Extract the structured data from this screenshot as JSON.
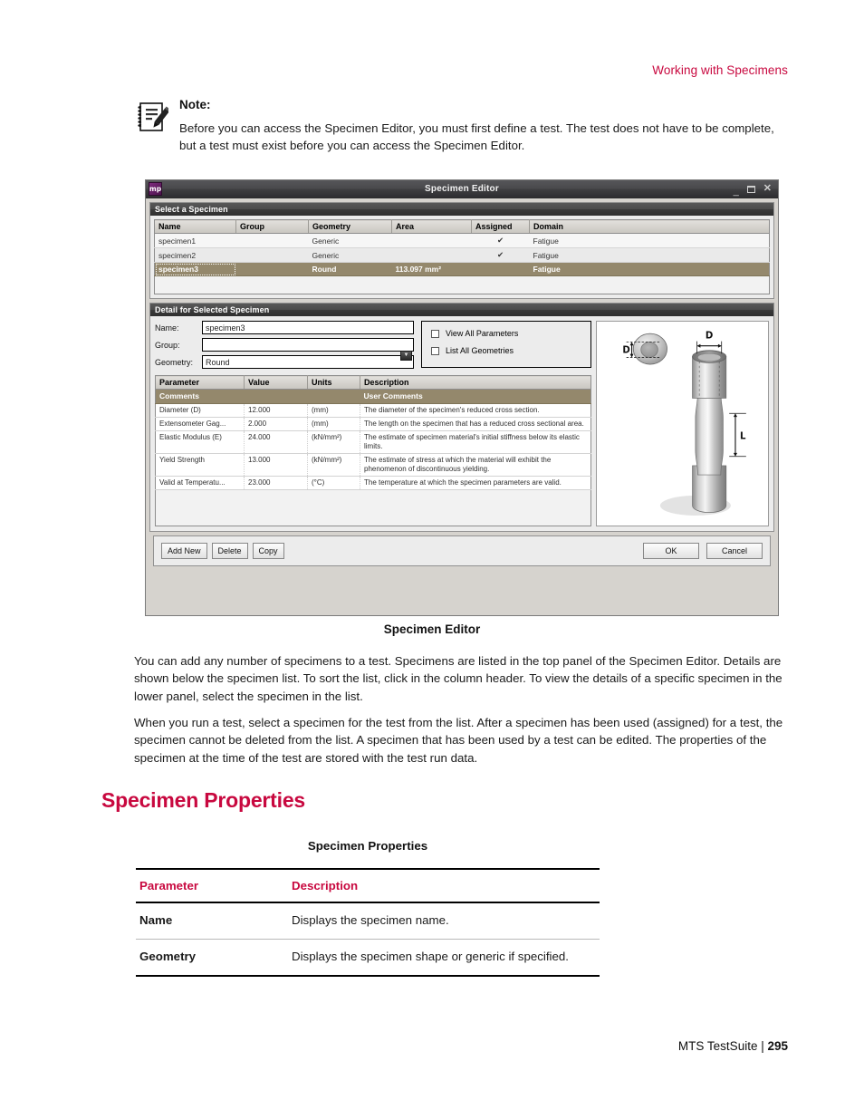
{
  "page": {
    "running_head": "Working with Specimens",
    "footer_label": "MTS TestSuite | ",
    "footer_page": "295"
  },
  "note": {
    "icon": "notepad-pencil-icon",
    "title": "Note:",
    "text": "Before you can access the Specimen Editor, you must first define a test. The test does not have to be complete, but a test must exist before you can access the Specimen Editor."
  },
  "app_window": {
    "app_icon_text": "mp",
    "title": "Specimen Editor",
    "controls": {
      "minimize": "_",
      "maximize": "maximize-icon",
      "close": "×"
    },
    "select_panel": {
      "header": "Select a Specimen",
      "columns": [
        "Name",
        "Group",
        "Geometry",
        "Area",
        "Assigned",
        "Domain"
      ],
      "rows": [
        {
          "name": "specimen1",
          "group": "",
          "geometry": "Generic",
          "area": "",
          "assigned": "✔",
          "domain": "Fatigue",
          "selected": false
        },
        {
          "name": "specimen2",
          "group": "",
          "geometry": "Generic",
          "area": "",
          "assigned": "✔",
          "domain": "Fatigue",
          "selected": false
        },
        {
          "name": "specimen3",
          "group": "",
          "geometry": "Round",
          "area": "113.097 mm²",
          "assigned": "",
          "domain": "Fatigue",
          "selected": true
        }
      ]
    },
    "detail_panel": {
      "header": "Detail for Selected Specimen",
      "fields": {
        "name_label": "Name:",
        "name_value": "specimen3",
        "group_label": "Group:",
        "group_value": "",
        "geometry_label": "Geometry:",
        "geometry_value": "Round"
      },
      "checkboxes": [
        {
          "label": "View All Parameters",
          "checked": false
        },
        {
          "label": "List All Geometries",
          "checked": false
        }
      ],
      "param_columns": [
        "Parameter",
        "Value",
        "Units",
        "Description"
      ],
      "comments_row": {
        "parameter": "Comments",
        "description": "User Comments"
      },
      "param_rows": [
        {
          "parameter": "Diameter (D)",
          "value": "12.000",
          "units": "(mm)",
          "description": "The diameter of the specimen's reduced cross section."
        },
        {
          "parameter": "Extensometer Gag...",
          "value": "2.000",
          "units": "(mm)",
          "description": "The length on the specimen that has a reduced cross sectional area."
        },
        {
          "parameter": "Elastic Modulus (E)",
          "value": "24.000",
          "units": "(kN/mm²)",
          "description": "The estimate of specimen material's initial stiffness below its elastic limits."
        },
        {
          "parameter": "Yield Strength",
          "value": "13.000",
          "units": "(kN/mm²)",
          "description": "The estimate of stress at which the material will exhibit the phenomenon of discontinuous yielding."
        },
        {
          "parameter": "Valid at Temperatu...",
          "value": "23.000",
          "units": "(°C)",
          "description": "The temperature at which the specimen parameters are valid."
        }
      ],
      "illustration": {
        "name": "round-specimen-diagram",
        "diameter_label": "D",
        "diameter_label_top": "D",
        "length_label": "L"
      }
    },
    "buttons": {
      "add_new": "Add New",
      "delete": "Delete",
      "copy": "Copy",
      "ok": "OK",
      "cancel": "Cancel"
    }
  },
  "figure_caption": "Specimen Editor",
  "paragraphs": {
    "p1": "You can add any number of specimens to a test. Specimens are listed in the top panel of the Specimen Editor. Details are shown below the specimen list. To sort the list, click in the column header. To view the details of a specific specimen in the lower panel, select the specimen in the list.",
    "p2": "When you run a test, select a specimen for the test from the list. After a specimen has been used (assigned) for a test, the specimen cannot be deleted from the list. A specimen that has been used by a test can be edited. The properties of the specimen at the time of the test are stored with the test run data."
  },
  "section_heading": "Specimen Properties",
  "properties_table": {
    "title": "Specimen Properties",
    "columns": [
      "Parameter",
      "Description"
    ],
    "rows": [
      {
        "parameter": "Name",
        "description": "Displays the specimen name."
      },
      {
        "parameter": "Geometry",
        "description": "Displays the specimen shape or generic if specified."
      }
    ]
  },
  "colors": {
    "accent_red": "#c8083f",
    "selection_tan": "#94886c",
    "titlebar_dark": "#3d3d40",
    "app_icon_purple": "#6d246d"
  }
}
